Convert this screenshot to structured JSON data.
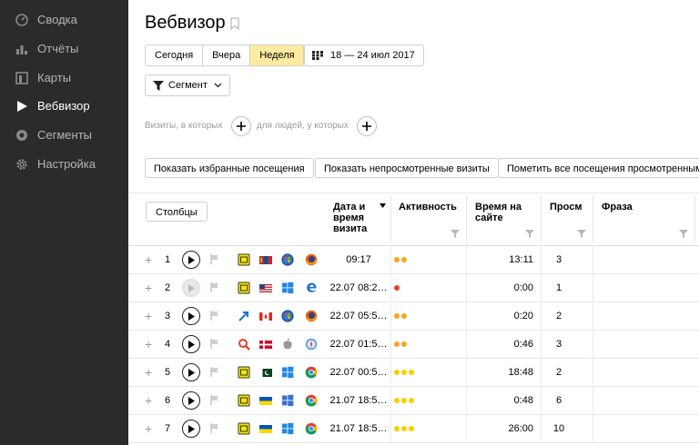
{
  "sidebar": {
    "items": [
      {
        "label": "Сводка",
        "icon": "gauge-icon",
        "active": false
      },
      {
        "label": "Отчёты",
        "icon": "bar-chart-icon",
        "active": false
      },
      {
        "label": "Карты",
        "icon": "map-icon",
        "active": false
      },
      {
        "label": "Вебвизор",
        "icon": "play-icon",
        "active": true
      },
      {
        "label": "Сегменты",
        "icon": "segments-icon",
        "active": false
      },
      {
        "label": "Настройка",
        "icon": "gear-icon",
        "active": false
      }
    ]
  },
  "header": {
    "title": "Вебвизор"
  },
  "period": {
    "today": "Сегодня",
    "yesterday": "Вчера",
    "week": "Неделя",
    "selected": "Неделя"
  },
  "date_range": "18 — 24 июл 2017",
  "segment_label": "Сегмент",
  "conditions": {
    "visits": "Визиты, в которых",
    "people": "для людей, у которых"
  },
  "actions": {
    "show_favorites": "Показать избранные посещения",
    "show_unviewed": "Показать непросмотренные визиты",
    "mark_all_viewed": "Пометить все посещения просмотренными"
  },
  "table": {
    "columns_button": "Столбцы",
    "headers": {
      "date_line1": "Дата и",
      "date_line2": "время",
      "date_line3": "визита",
      "activity": "Активность",
      "duration_line1": "Время на",
      "duration_line2": "сайте",
      "pageviews": "Просм",
      "phrase": "Фраза"
    },
    "rows": [
      {
        "num": "1",
        "datetime": "09:17",
        "activity": 2,
        "activity_color": "#f5a623",
        "duration": "13:11",
        "pageviews": "3",
        "icons": [
          "yandex-source-icon",
          "mongolia-flag-icon",
          "windows7-icon",
          "firefox-icon"
        ],
        "play_dim": false
      },
      {
        "num": "2",
        "datetime": "22.07 08:2…",
        "activity": 1,
        "activity_color": "#e8402b",
        "duration": "0:00",
        "pageviews": "1",
        "icons": [
          "yandex-source-icon",
          "usa-flag-icon",
          "windows10-icon",
          "edge-icon"
        ],
        "play_dim": true
      },
      {
        "num": "3",
        "datetime": "22.07 05:5…",
        "activity": 2,
        "activity_color": "#f5a623",
        "duration": "0:20",
        "pageviews": "2",
        "icons": [
          "link-arrow-icon",
          "canada-flag-icon",
          "windows7-icon",
          "firefox-icon"
        ],
        "play_dim": false
      },
      {
        "num": "4",
        "datetime": "22.07 01:5…",
        "activity": 2,
        "activity_color": "#f5a623",
        "duration": "0:46",
        "pageviews": "3",
        "icons": [
          "search-engine-icon",
          "denmark-flag-icon",
          "apple-icon",
          "safari-icon"
        ],
        "play_dim": false
      },
      {
        "num": "5",
        "datetime": "22.07 00:5…",
        "activity": 3,
        "activity_color": "#f7d000",
        "duration": "18:48",
        "pageviews": "2",
        "icons": [
          "yandex-source-icon",
          "pakistan-flag-icon",
          "windows10-icon",
          "chrome-icon"
        ],
        "play_dim": false
      },
      {
        "num": "6",
        "datetime": "21.07 18:5…",
        "activity": 3,
        "activity_color": "#f7d000",
        "duration": "0:48",
        "pageviews": "6",
        "icons": [
          "yandex-source-icon",
          "ukraine-flag-icon",
          "windows-icon",
          "chrome-icon"
        ],
        "play_dim": false
      },
      {
        "num": "7",
        "datetime": "21.07 18:5…",
        "activity": 3,
        "activity_color": "#f7d000",
        "duration": "26:00",
        "pageviews": "10",
        "icons": [
          "yandex-source-icon",
          "ukraine-flag-icon",
          "windows10-icon",
          "chrome-icon"
        ],
        "play_dim": false
      }
    ]
  }
}
